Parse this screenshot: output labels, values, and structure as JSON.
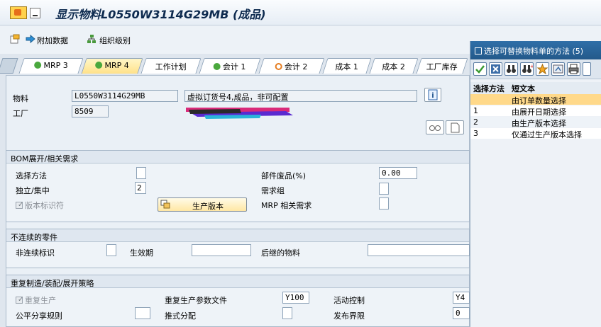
{
  "title": "显示物料L0550W3114G29MB (成品)",
  "toolbar": {
    "additional_data": "附加数据",
    "org_levels": "组织级别"
  },
  "tabs": [
    "MRP 3",
    "MRP 4",
    "工作计划",
    "会计 1",
    "会计 2",
    "成本 1",
    "成本 2",
    "工厂库存"
  ],
  "header": {
    "material_label": "物料",
    "material_value": "L0550W3114G29MB",
    "material_desc": "虚拟订货号4,成品，非可配置",
    "plant_label": "工厂",
    "plant_value": "8509"
  },
  "bom_group": {
    "title": "BOM展开/相关需求",
    "selection_method_label": "选择方法",
    "indiv_collective_label": "独立/集中",
    "indiv_collective_value": "2",
    "version_indicator_label": "版本标识符",
    "production_version_button": "生产版本",
    "component_scrap_label": "部件废品(%)",
    "component_scrap_value": "0.00",
    "requirements_group_label": "需求组",
    "mrp_dep_req_label": "MRP 相关需求"
  },
  "disc_group": {
    "title": "不连续的零件",
    "disc_indicator_label": "非连续标识",
    "effective_out_label": "生效期",
    "follow_up_label": "后继的物料"
  },
  "rep_group": {
    "title": "重复制造/装配/展开策略",
    "repetitive_mfg_label": "重复生产",
    "rem_profile_label": "重复生产参数文件",
    "rem_profile_value": "Y100",
    "action_control_label": "活动控制",
    "action_control_value": "Y4",
    "fair_share_label": "公平分享规则",
    "push_dist_label": "推式分配",
    "deployment_horizon_label": "发布界限",
    "deployment_horizon_value": "0"
  },
  "popup": {
    "title": "选择可替换物料单的方法 (5)",
    "col1": "选择方法",
    "col2": "短文本",
    "rows": [
      {
        "code": "",
        "text": "由订单数量选择"
      },
      {
        "code": "1",
        "text": "由展开日期选择"
      },
      {
        "code": "2",
        "text": "由生产版本选择"
      },
      {
        "code": "3",
        "text": "仅通过生产版本选择"
      }
    ]
  },
  "colors": {
    "selected_row": "#ffd98a",
    "popup_header": "#2f6fa8"
  }
}
